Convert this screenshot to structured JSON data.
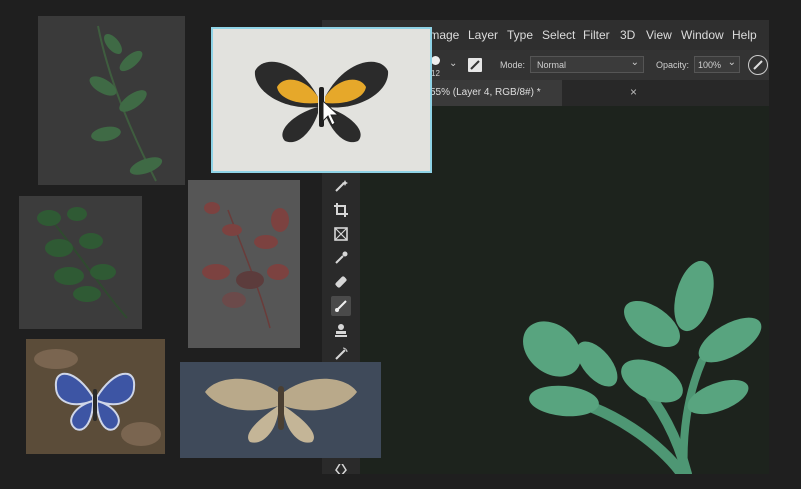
{
  "menu": [
    "Image",
    "Layer",
    "Type",
    "Select",
    "Filter",
    "3D",
    "View",
    "Window",
    "Help"
  ],
  "options": {
    "brush_size": "12",
    "mode_label": "Mode:",
    "mode_value": "Normal",
    "opacity_label": "Opacity:",
    "opacity_value": "100%"
  },
  "document_tab": {
    "title": "55% (Layer 4, RGB/8#) *",
    "close": "×"
  },
  "tools": [
    "magic-wand",
    "crop",
    "frame",
    "eyedropper",
    "healing-brush",
    "brush",
    "clone-stamp",
    "history-brush",
    "eraser",
    "gradient",
    "blur",
    "dodge",
    "pen"
  ],
  "active_tool": "brush",
  "colors": {
    "ps_background": "#1b1e1b",
    "menubar": "#2f2f2f",
    "leaf_green": "#4e9774",
    "selection": "#8fd3e6"
  }
}
